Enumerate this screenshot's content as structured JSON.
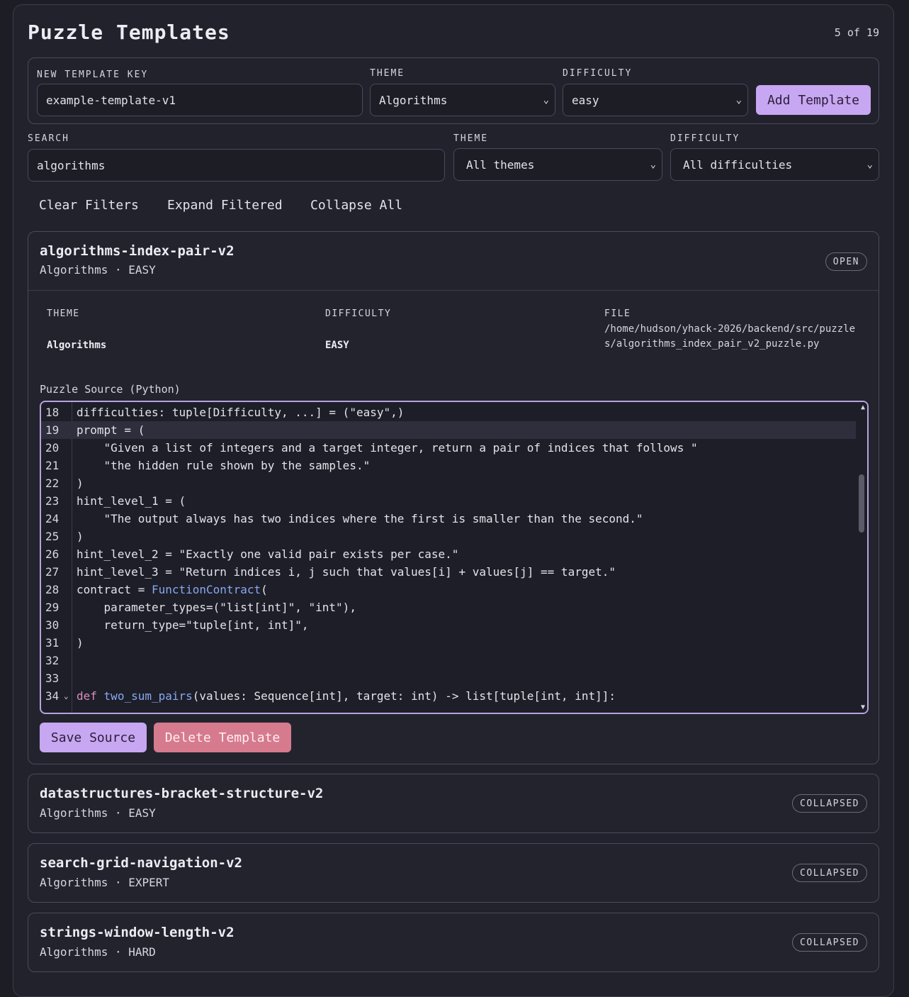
{
  "header": {
    "title": "Puzzle Templates",
    "count": "5 of 19"
  },
  "new_template": {
    "key_label": "NEW TEMPLATE KEY",
    "key_value": "example-template-v1",
    "theme_label": "THEME",
    "theme_value": "Algorithms",
    "difficulty_label": "DIFFICULTY",
    "difficulty_value": "easy",
    "add_button": "Add Template"
  },
  "filters": {
    "search_label": "SEARCH",
    "search_value": "algorithms",
    "theme_label": "THEME",
    "theme_value": "All themes",
    "difficulty_label": "DIFFICULTY",
    "difficulty_value": "All difficulties",
    "clear": "Clear Filters",
    "expand": "Expand Filtered",
    "collapse": "Collapse All"
  },
  "templates": [
    {
      "key": "algorithms-index-pair-v2",
      "meta": "Algorithms · EASY",
      "status": "OPEN",
      "theme_label": "THEME",
      "theme": "Algorithms",
      "difficulty_label": "DIFFICULTY",
      "difficulty": "EASY",
      "file_label": "FILE",
      "file": "/home/hudson/yhack-2026/backend/src/puzzles/algorithms_index_pair_v2_puzzle.py",
      "source_label": "Puzzle Source (Python)",
      "save_button": "Save Source",
      "delete_button": "Delete Template"
    },
    {
      "key": "datastructures-bracket-structure-v2",
      "meta": "Algorithms · EASY",
      "status": "COLLAPSED"
    },
    {
      "key": "search-grid-navigation-v2",
      "meta": "Algorithms · EXPERT",
      "status": "COLLAPSED"
    },
    {
      "key": "strings-window-length-v2",
      "meta": "Algorithms · HARD",
      "status": "COLLAPSED"
    }
  ],
  "code": {
    "line_numbers": [
      "18",
      "19",
      "20",
      "21",
      "22",
      "23",
      "24",
      "25",
      "26",
      "27",
      "28",
      "29",
      "30",
      "31",
      "32",
      "33",
      "34"
    ],
    "lines": [
      "difficulties: tuple[Difficulty, ...] = (\"easy\",)",
      "prompt = (",
      "    \"Given a list of integers and a target integer, return a pair of indices that follows \"",
      "    \"the hidden rule shown by the samples.\"",
      ")",
      "hint_level_1 = (",
      "    \"The output always has two indices where the first is smaller than the second.\"",
      ")",
      "hint_level_2 = \"Exactly one valid pair exists per case.\"",
      "hint_level_3 = \"Return indices i, j such that values[i] + values[j] == target.\"",
      "contract = ",
      "    parameter_types=(\"list[int]\", \"int\"),",
      "    return_type=\"tuple[int, int]\",",
      ")",
      "",
      "",
      ""
    ],
    "line28_fn": "FunctionContract",
    "line28_tail": "(",
    "line34_kw": "def",
    "line34_fn": "two_sum_pairs",
    "line34_tail": "(values: Sequence[int], target: int) -> list[tuple[int, int]]:"
  },
  "icons": {
    "select": "chevron-down-icon",
    "fold": "fold-chevron-icon"
  }
}
